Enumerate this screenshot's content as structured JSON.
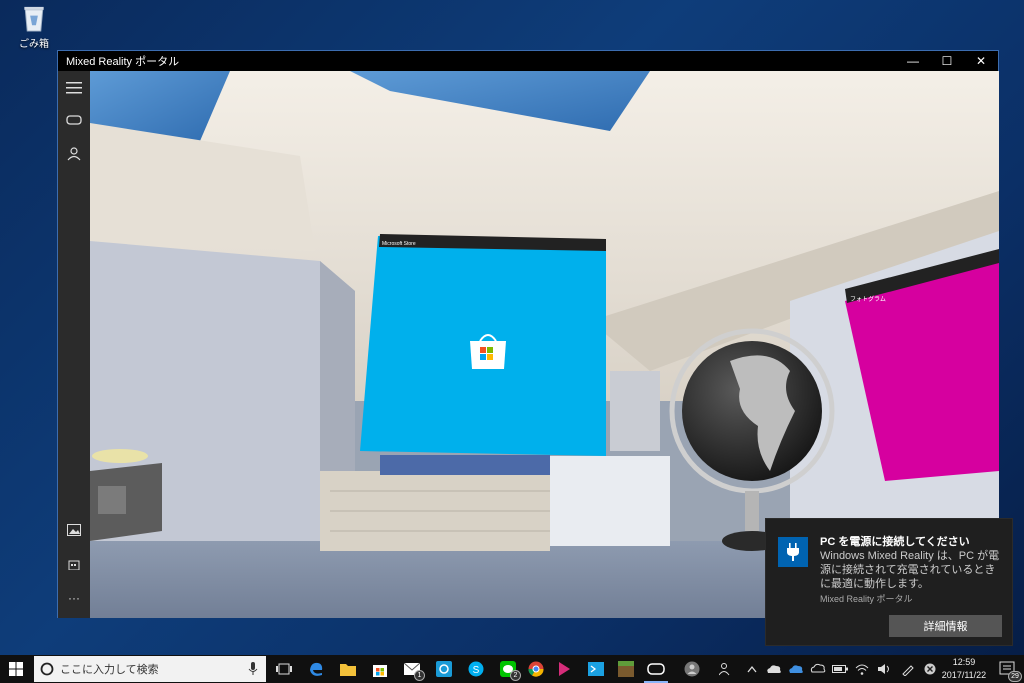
{
  "desktop": {
    "recycle_bin_label": "ごみ箱"
  },
  "window": {
    "title": "Mixed Reality ポータル",
    "minimize_glyph": "—",
    "maximize_glyph": "☐",
    "close_glyph": "✕",
    "sidebar_more_glyph": "···"
  },
  "scene": {
    "store_panel_title": "Microsoft Store",
    "photos_panel_title": "フォトグラム"
  },
  "toast": {
    "title": "PC を電源に接続してください",
    "body": "Windows Mixed Reality は、PC が電源に接続されて充電されているときに最適に動作します。",
    "app_name": "Mixed Reality ポータル",
    "button_label": "詳細情報"
  },
  "taskbar": {
    "search_placeholder": "ここに入力して検索",
    "mail_badge": "1",
    "line_badge": "2",
    "time": "12:59",
    "date": "2017/11/22",
    "notification_count": "29"
  },
  "colors": {
    "store_blue": "#00b0ec",
    "photos_magenta": "#d6009f",
    "accent": "#0063b1"
  }
}
